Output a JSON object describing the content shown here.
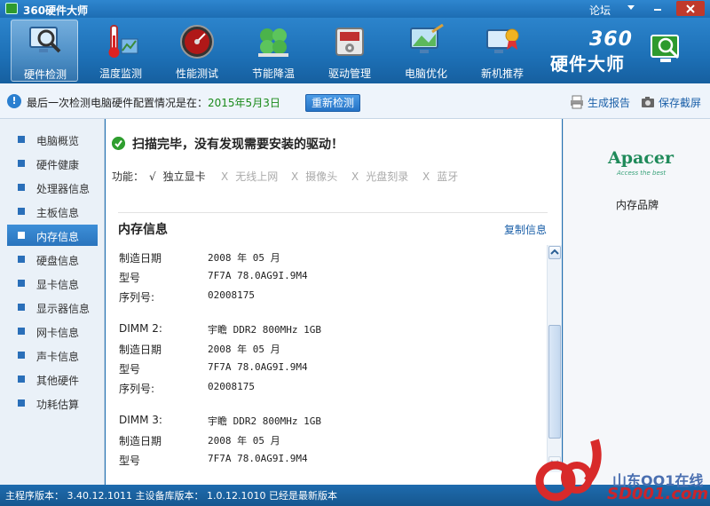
{
  "window": {
    "title": "360硬件大师",
    "forum_link": "论坛"
  },
  "toolbar": {
    "tools": [
      {
        "label": "硬件检测",
        "icon": "monitor-magnifier-icon"
      },
      {
        "label": "温度监测",
        "icon": "thermometer-icon"
      },
      {
        "label": "性能测试",
        "icon": "speedometer-icon"
      },
      {
        "label": "节能降温",
        "icon": "clover-icon"
      },
      {
        "label": "驱动管理",
        "icon": "driver-chip-icon"
      },
      {
        "label": "电脑优化",
        "icon": "brush-monitor-icon"
      },
      {
        "label": "新机推荐",
        "icon": "award-computer-icon"
      }
    ],
    "brand_number": "360",
    "brand_name": "硬件大师"
  },
  "infobar": {
    "text": "最后一次检测电脑硬件配置情况是在：",
    "date": "2015年5月3日",
    "redetect_label": "重新检测",
    "report_label": "生成报告",
    "screenshot_label": "保存截屏"
  },
  "sidebar": {
    "items": [
      {
        "label": "电脑概览"
      },
      {
        "label": "硬件健康"
      },
      {
        "label": "处理器信息"
      },
      {
        "label": "主板信息"
      },
      {
        "label": "内存信息",
        "active": true
      },
      {
        "label": "硬盘信息"
      },
      {
        "label": "显卡信息"
      },
      {
        "label": "显示器信息"
      },
      {
        "label": "网卡信息"
      },
      {
        "label": "声卡信息"
      },
      {
        "label": "其他硬件"
      },
      {
        "label": "功耗估算"
      }
    ]
  },
  "main": {
    "scan_status": "扫描完毕，没有发现需要安装的驱动！",
    "features_label": "功能：",
    "features": [
      {
        "mark": "√",
        "label": "独立显卡",
        "ok": true
      },
      {
        "mark": "X",
        "label": "无线上网",
        "ok": false
      },
      {
        "mark": "X",
        "label": "摄像头",
        "ok": false
      },
      {
        "mark": "X",
        "label": "光盘刻录",
        "ok": false
      },
      {
        "mark": "X",
        "label": "蓝牙",
        "ok": false
      }
    ],
    "section_title": "内存信息",
    "copy_label": "复制信息",
    "memory_rows": [
      {
        "key": "制造日期",
        "value": "2008 年 05 月"
      },
      {
        "key": "型号",
        "value": "7F7A 78.0AG9I.9M4"
      },
      {
        "key": "序列号:",
        "value": "02008175"
      },
      {
        "key": "DIMM 2:",
        "value": "宇瞻 DDR2 800MHz 1GB"
      },
      {
        "key": "制造日期",
        "value": "2008 年 05 月"
      },
      {
        "key": "型号",
        "value": "7F7A 78.0AG9I.9M4"
      },
      {
        "key": "序列号:",
        "value": "02008175"
      },
      {
        "key": "DIMM 3:",
        "value": "宇瞻 DDR2 800MHz 1GB"
      },
      {
        "key": "制造日期",
        "value": "2008 年 05 月"
      },
      {
        "key": "型号",
        "value": "7F7A 78.0AG9I.9M4"
      }
    ]
  },
  "right_panel": {
    "logo_name": "Apacer",
    "logo_tagline": "Access the best",
    "brand_label": "内存品牌"
  },
  "statusbar": {
    "text": "主程序版本： 3.40.12.1011   主设备库版本： 1.0.12.1010   已经是最新版本"
  },
  "watermark": {
    "line1": "山东OO1在线",
    "line2": "SD001.com"
  },
  "colors": {
    "accent": "#1f6fb2",
    "link": "#1a5fa8",
    "date": "#1a8a1a",
    "ok": "#2f9e2f"
  }
}
